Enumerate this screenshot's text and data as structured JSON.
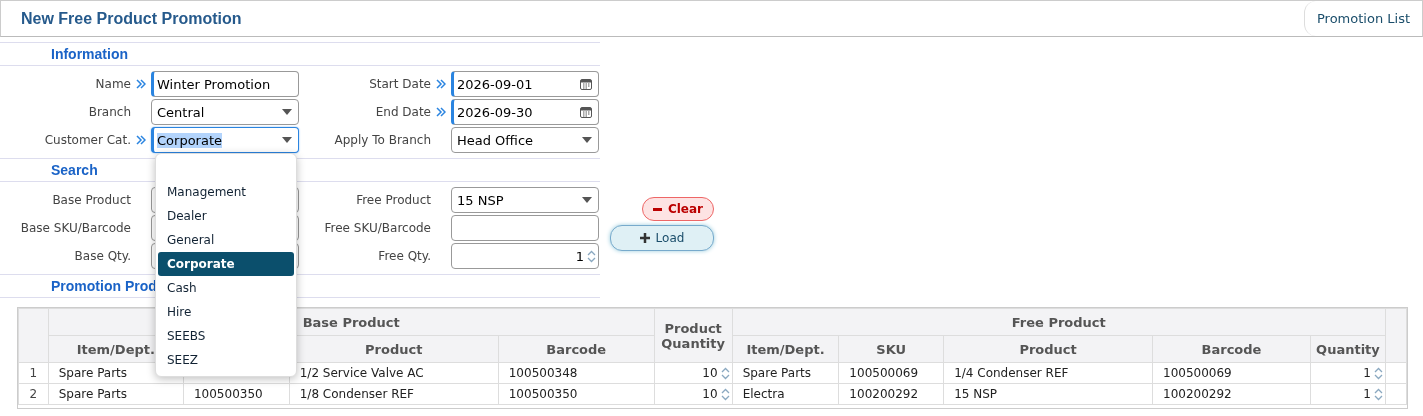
{
  "header": {
    "title": "New Free Product Promotion",
    "promotion_list_button": "Promotion List"
  },
  "information": {
    "title": "Information",
    "fields": [
      {
        "label": "Name",
        "kind": "text",
        "value": "Winter Promotion",
        "required": true,
        "focused": false
      },
      {
        "label": "Start Date",
        "kind": "date",
        "value": "2026-09-01",
        "required": true,
        "focused": false
      },
      {
        "label": "Branch",
        "kind": "select",
        "value": "Central",
        "required": false,
        "focused": false
      },
      {
        "label": "End Date",
        "kind": "date",
        "value": "2026-09-30",
        "required": true,
        "focused": false
      },
      {
        "label": "Customer Cat.",
        "kind": "select",
        "value": "Corporate",
        "required": true,
        "focused": true
      },
      {
        "label": "Apply To Branch",
        "kind": "select",
        "value": "Head Office",
        "required": false,
        "focused": false
      }
    ]
  },
  "customer_cat_dropdown": {
    "options": [
      {
        "label": "Management",
        "selected": false
      },
      {
        "label": "Dealer",
        "selected": false
      },
      {
        "label": "General",
        "selected": false
      },
      {
        "label": "Corporate",
        "selected": true
      },
      {
        "label": "Cash",
        "selected": false
      },
      {
        "label": "Hire",
        "selected": false
      },
      {
        "label": "SEEBS",
        "selected": false
      },
      {
        "label": "SEEZ",
        "selected": false
      }
    ]
  },
  "search": {
    "title": "Search",
    "fields": [
      {
        "label": "Base Product",
        "kind": "select",
        "required": false,
        "focused": false
      },
      {
        "label": "Free Product",
        "kind": "select",
        "value": "15 NSP",
        "required": false,
        "focused": false
      },
      {
        "label": "Base SKU/Barcode",
        "kind": "text",
        "required": false,
        "focused": false
      },
      {
        "label": "Free SKU/Barcode",
        "kind": "text",
        "required": false,
        "focused": false
      },
      {
        "label": "Base Qty.",
        "kind": "number",
        "required": false,
        "focused": false
      },
      {
        "label": "Free Qty.",
        "kind": "number",
        "value": "1",
        "required": false,
        "focused": false
      }
    ],
    "buttons": [
      {
        "label": "Clear",
        "kind": "danger"
      },
      {
        "label": "Load",
        "kind": "primary"
      }
    ]
  },
  "promotion_products": {
    "title": "Promotion Prod",
    "table": {
      "base_group": "Base Product",
      "free_group": "Free Product",
      "product_quantity": "Product Quantity",
      "base_columns": [
        {
          "label": "Item/Dept."
        },
        {},
        {
          "label": "Product"
        },
        {
          "label": "Barcode"
        }
      ],
      "free_columns": [
        {
          "label": "Item/Dept."
        },
        {
          "label": "SKU"
        },
        {
          "label": "Product"
        },
        {
          "label": "Barcode"
        },
        {
          "label": "Quantity"
        }
      ],
      "rows": [
        {
          "index": "1",
          "base_item": "Spare Parts",
          "base_product": "1/2 Service Valve AC",
          "base_barcode": "100500348",
          "base_qty": "10",
          "free_item": "Spare Parts",
          "free_sku": "100500069",
          "free_product": "1/4 Condenser REF",
          "free_barcode": "100500069",
          "free_qty": "1"
        },
        {
          "index": "2",
          "base_item": "Spare Parts",
          "base_sku": "100500350",
          "base_product": "1/8 Condenser REF",
          "base_barcode": "100500350",
          "base_qty": "10",
          "free_item": "Electra",
          "free_sku": "100200292",
          "free_product": "15 NSP",
          "free_barcode": "100200292",
          "free_qty": "1"
        }
      ]
    }
  }
}
